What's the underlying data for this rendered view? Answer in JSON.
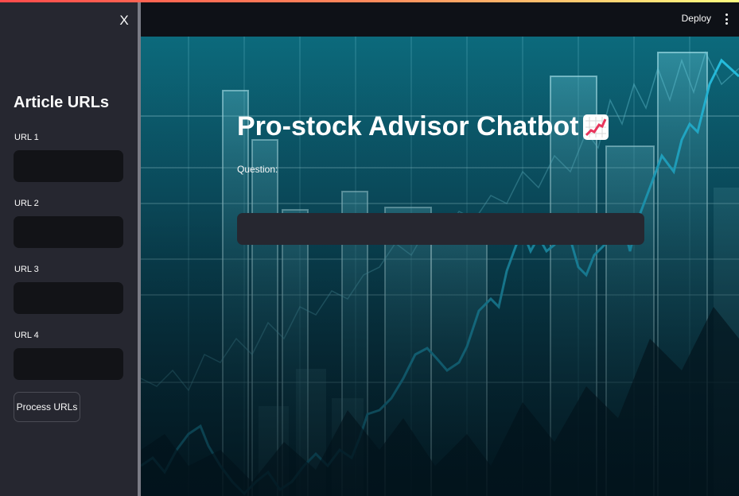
{
  "header": {
    "deploy_label": "Deploy"
  },
  "sidebar": {
    "close_label": "X",
    "title": "Article URLs",
    "urls": [
      {
        "label": "URL 1",
        "value": ""
      },
      {
        "label": "URL 2",
        "value": ""
      },
      {
        "label": "URL 3",
        "value": ""
      },
      {
        "label": "URL 4",
        "value": ""
      }
    ],
    "process_label": "Process URLs"
  },
  "main": {
    "title": "Pro-stock Advisor Chatbot",
    "title_icon": "chart-increasing-icon",
    "question_label": "Question:",
    "question_value": ""
  },
  "colors": {
    "sidebar_bg": "#262730",
    "app_bg": "#0e1117",
    "input_bg": "#121317",
    "main_input_bg": "#262730",
    "background_teal": "#0c6a7c"
  }
}
